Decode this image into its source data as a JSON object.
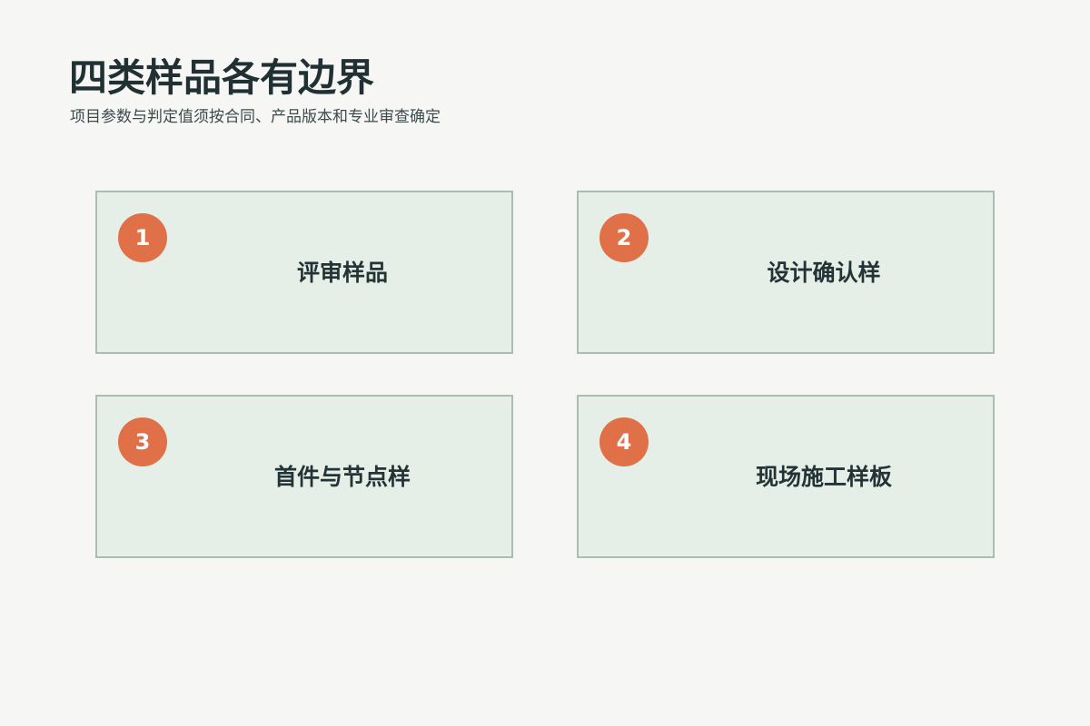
{
  "page": {
    "title": "四类样品各有边界",
    "subtitle": "项目参数与判定值须按合同、产品版本和专业审查确定"
  },
  "cards": [
    {
      "number": "1",
      "label": "评审样品"
    },
    {
      "number": "2",
      "label": "设计确认样"
    },
    {
      "number": "3",
      "label": "首件与节点样"
    },
    {
      "number": "4",
      "label": "现场施工样板"
    }
  ],
  "colors": {
    "background": "#f6f6f4",
    "card_fill": "#e5efe8",
    "card_border": "#a9bdb4",
    "badge": "#e07048",
    "text": "#243436"
  }
}
